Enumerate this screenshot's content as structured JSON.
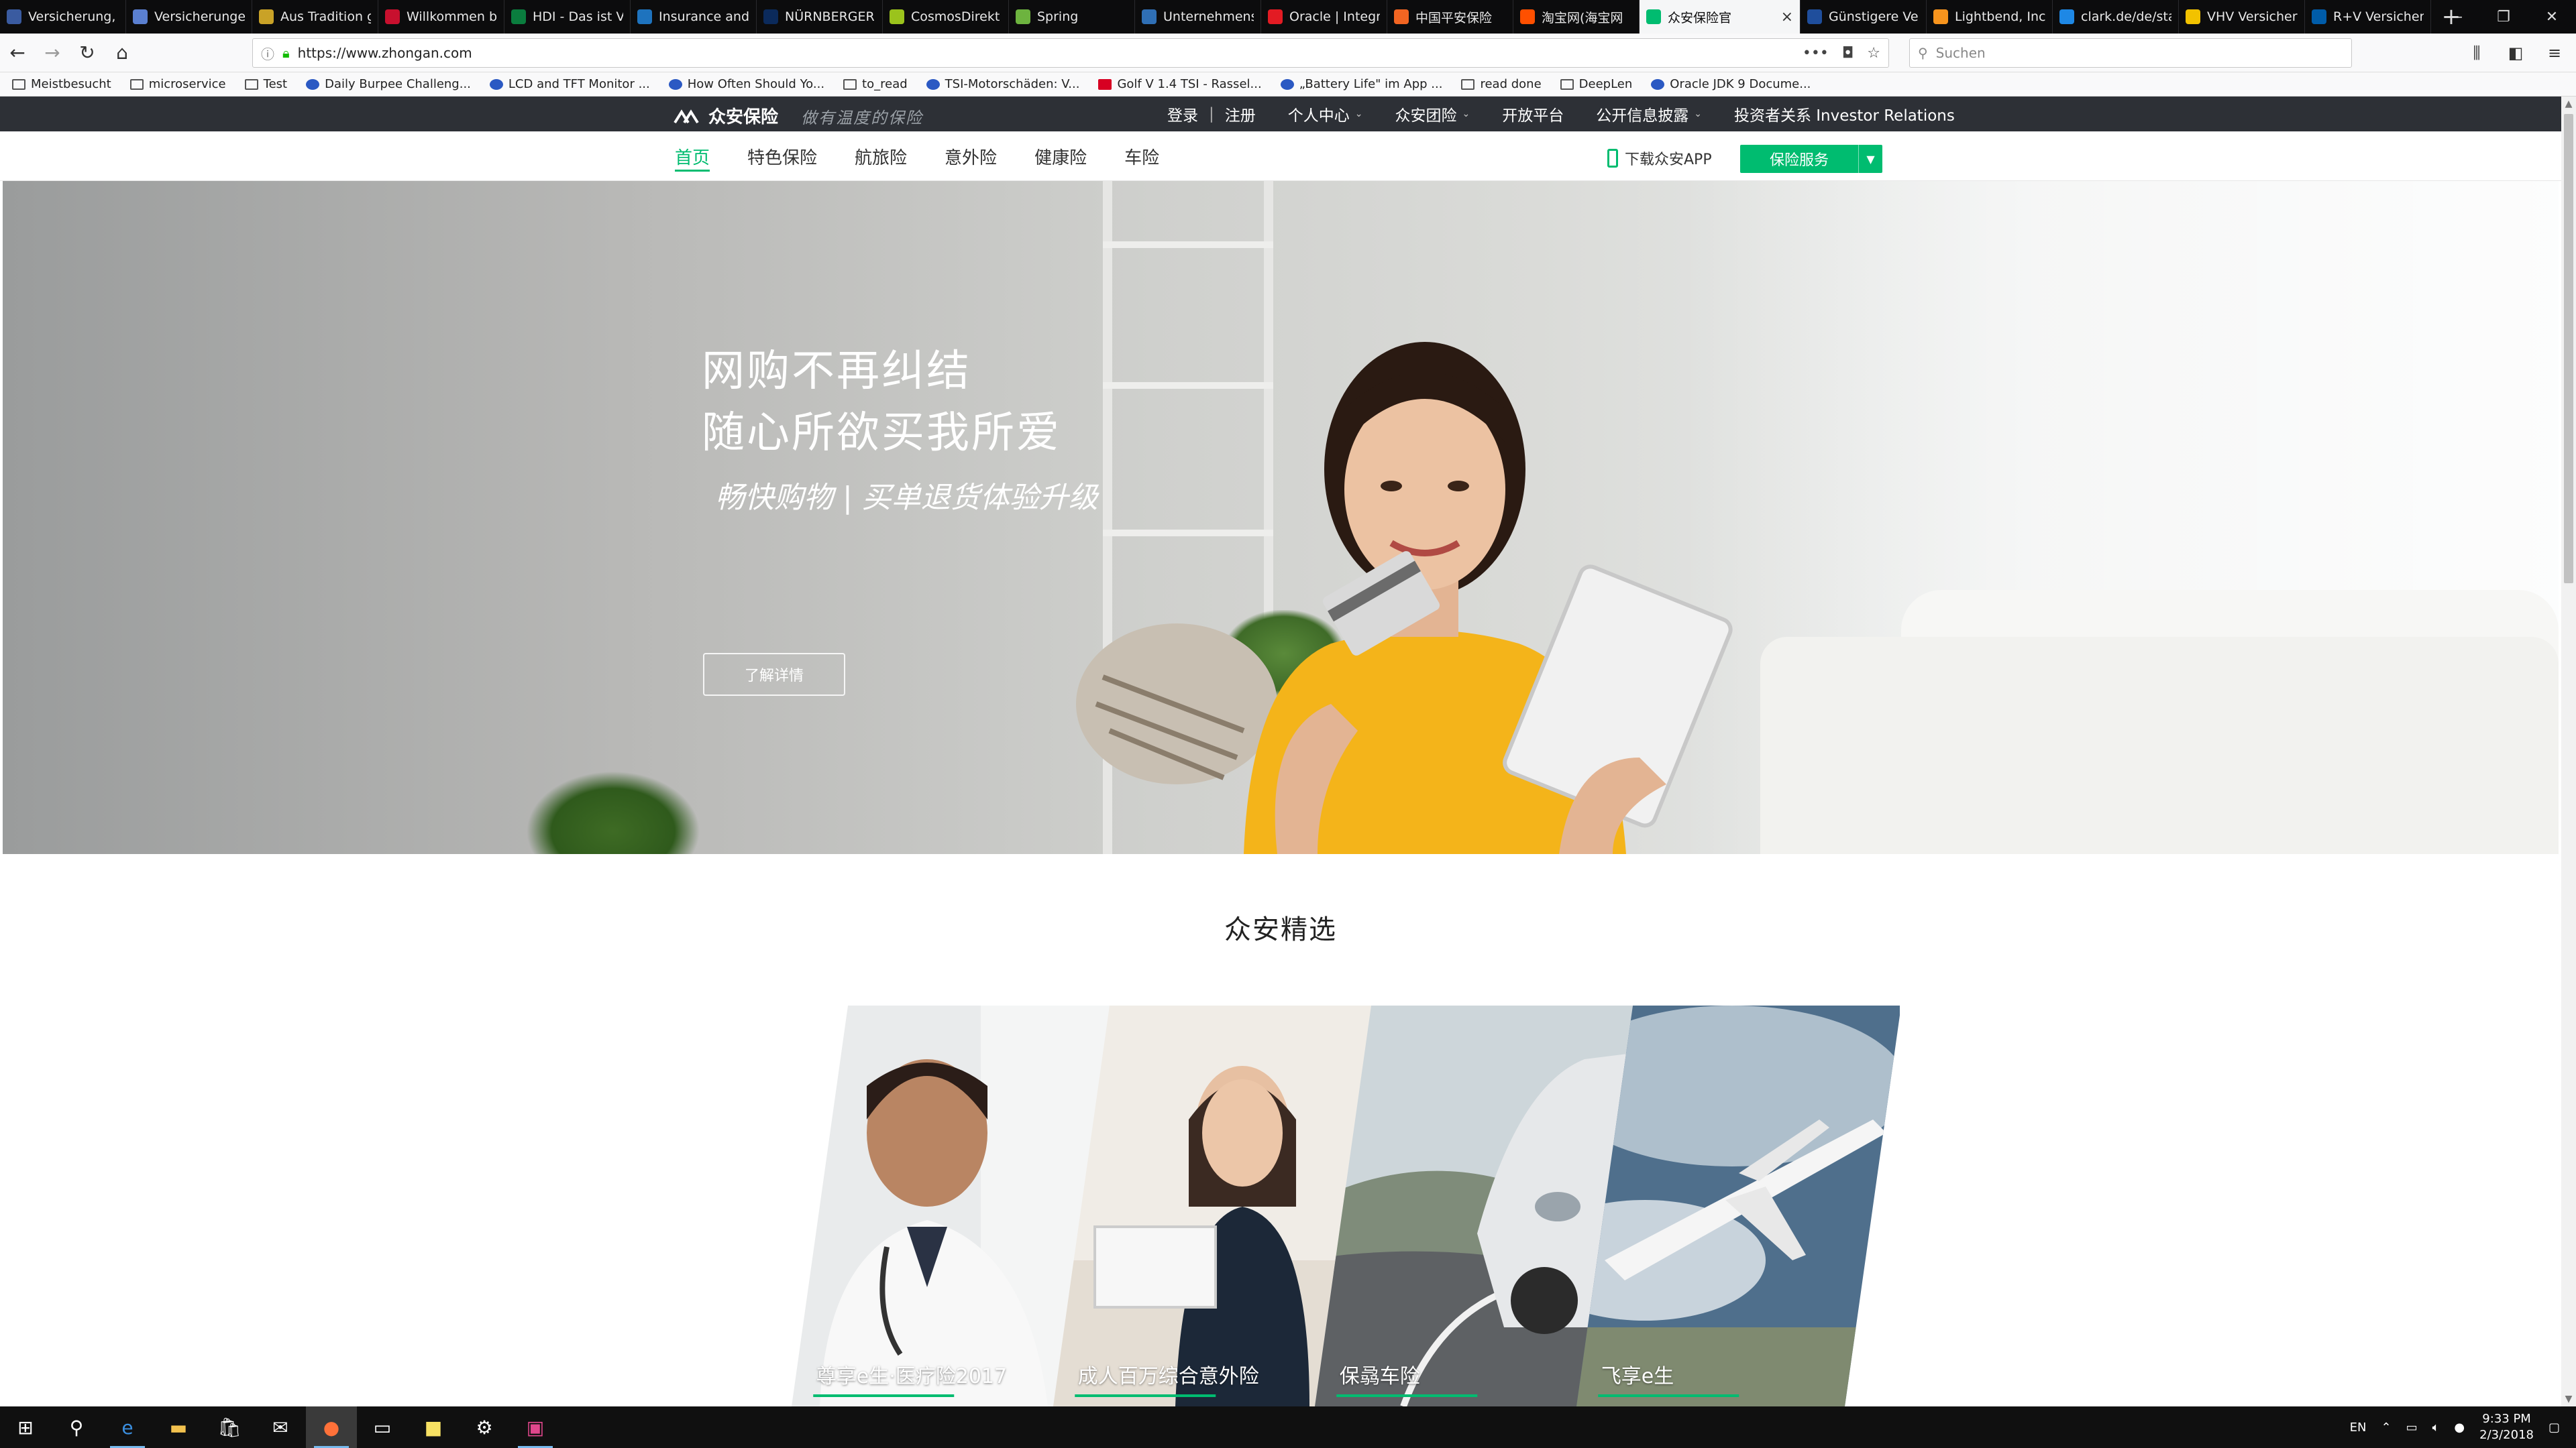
{
  "browser": {
    "tabs": [
      {
        "label": "Versicherung, V",
        "color": "#3a5ba0"
      },
      {
        "label": "Versicherungen",
        "color": "#5a7fd0"
      },
      {
        "label": "Aus Tradition g",
        "color": "#c9a227"
      },
      {
        "label": "Willkommen b",
        "color": "#c8102e"
      },
      {
        "label": "HDI - Das ist V",
        "color": "#0a7d3e"
      },
      {
        "label": "Insurance and",
        "color": "#1e73be"
      },
      {
        "label": "NÜRNBERGER",
        "color": "#0b2a5b"
      },
      {
        "label": "CosmosDirekt",
        "color": "#9bc31c"
      },
      {
        "label": "Spring",
        "color": "#6db33f"
      },
      {
        "label": "Unternehmens",
        "color": "#2f6fb5"
      },
      {
        "label": "Oracle | Integr",
        "color": "#e31b23"
      },
      {
        "label": "中国平安保险",
        "color": "#f26522"
      },
      {
        "label": "淘宝网(海宝网",
        "color": "#ff5000"
      },
      {
        "label": "众安保险官",
        "color": "#00bc70",
        "active": true
      },
      {
        "label": "Günstigere Ver",
        "color": "#1f4e9c"
      },
      {
        "label": "Lightbend, Inc",
        "color": "#f7941d"
      },
      {
        "label": "clark.de/de/sta",
        "color": "#1e88e5"
      },
      {
        "label": "VHV Versicher",
        "color": "#f2c200"
      },
      {
        "label": "R+V Versichere",
        "color": "#005ca9"
      }
    ],
    "url": "https://www.zhongan.com",
    "search_placeholder": "Suchen",
    "bookmarks": [
      {
        "label": "Meistbesucht",
        "icon": "gear-icon"
      },
      {
        "label": "microservice",
        "icon": "folder-icon"
      },
      {
        "label": "Test",
        "icon": "folder-icon"
      },
      {
        "label": "Daily Burpee Challeng...",
        "icon": "site-icon"
      },
      {
        "label": "LCD and TFT Monitor ...",
        "icon": "site-icon"
      },
      {
        "label": "How Often Should Yo...",
        "icon": "site-icon"
      },
      {
        "label": "to_read",
        "icon": "folder-icon"
      },
      {
        "label": "TSI-Motorschäden: V...",
        "icon": "site-icon"
      },
      {
        "label": "Golf V 1.4 TSI - Rassel...",
        "icon": "youtube-icon"
      },
      {
        "label": "„Battery Life\" im App ...",
        "icon": "site-icon"
      },
      {
        "label": "read done",
        "icon": "folder-icon"
      },
      {
        "label": "DeepLen",
        "icon": "folder-icon"
      },
      {
        "label": "Oracle JDK 9 Docume...",
        "icon": "site-icon"
      }
    ]
  },
  "site": {
    "logo_text": "众安保险",
    "slogan": "做有温度的保险",
    "top_links": {
      "login": "登录",
      "register": "注册",
      "personal": "个人中心",
      "group": "众安团险",
      "open": "开放平台",
      "disclosure": "公开信息披露",
      "ir": "投资者关系 Investor Relations"
    },
    "menu": [
      "首页",
      "特色保险",
      "航旅险",
      "意外险",
      "健康险",
      "车险"
    ],
    "app_download": "下载众安APP",
    "service_button": "保险服务",
    "hero": {
      "line1": "网购不再纠结",
      "line2": "随心所欲买我所爱",
      "tagline": "畅快购物 | 买单退货体验升级",
      "button": "了解详情"
    },
    "section_title": "众安精选",
    "cards": [
      {
        "label": "尊享e生·医疗险2017"
      },
      {
        "label": "成人百万综合意外险"
      },
      {
        "label": "保骉车险"
      },
      {
        "label": "飞享e生"
      }
    ]
  },
  "taskbar": {
    "lang": "EN",
    "time": "9:33 PM",
    "date": "2/3/2018"
  },
  "colors": {
    "brand_green": "#00bc70",
    "topbar_bg": "#2d3036",
    "tab_bg": "#0c0c0d"
  }
}
